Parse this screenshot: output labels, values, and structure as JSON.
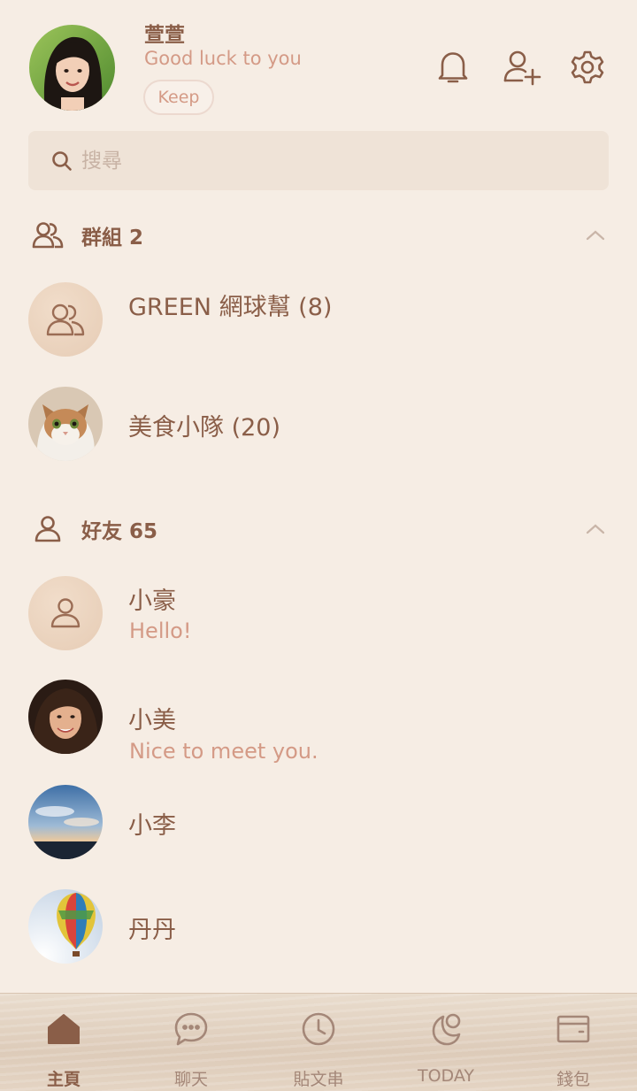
{
  "profile": {
    "name": "萱萱",
    "status": "Good luck to you",
    "keep_label": "Keep"
  },
  "header_icons": [
    "bell-icon",
    "add-friend-icon",
    "settings-gear-icon"
  ],
  "search": {
    "placeholder": "搜尋"
  },
  "groups": {
    "title": "群組 2",
    "items": [
      {
        "name": "GREEN 網球幫 (8)",
        "avatar": "group-placeholder-icon"
      },
      {
        "name": "美食小隊 (20)",
        "avatar": "cat-photo"
      }
    ]
  },
  "friends": {
    "title": "好友 65",
    "items": [
      {
        "name": "小豪",
        "message": "Hello!",
        "avatar": "person-placeholder-icon"
      },
      {
        "name": "小美",
        "message": "Nice to meet you.",
        "avatar": "woman-photo"
      },
      {
        "name": "小李",
        "message": "",
        "avatar": "sky-photo"
      },
      {
        "name": "丹丹",
        "message": "",
        "avatar": "hot-air-balloon-photo"
      }
    ]
  },
  "bottom_nav": [
    {
      "label": "主頁",
      "icon": "home-icon",
      "active": true
    },
    {
      "label": "聊天",
      "icon": "chat-bubble-icon",
      "active": false
    },
    {
      "label": "貼文串",
      "icon": "clock-icon",
      "active": false
    },
    {
      "label": "TODAY",
      "icon": "today-moon-icon",
      "active": false
    },
    {
      "label": "錢包",
      "icon": "wallet-icon",
      "active": false
    }
  ],
  "colors": {
    "background": "#f6ede4",
    "primary_text": "#8a5e48",
    "accent_text": "#d49a86",
    "search_bg": "#efe3d7",
    "nav_inactive": "#a48778"
  }
}
